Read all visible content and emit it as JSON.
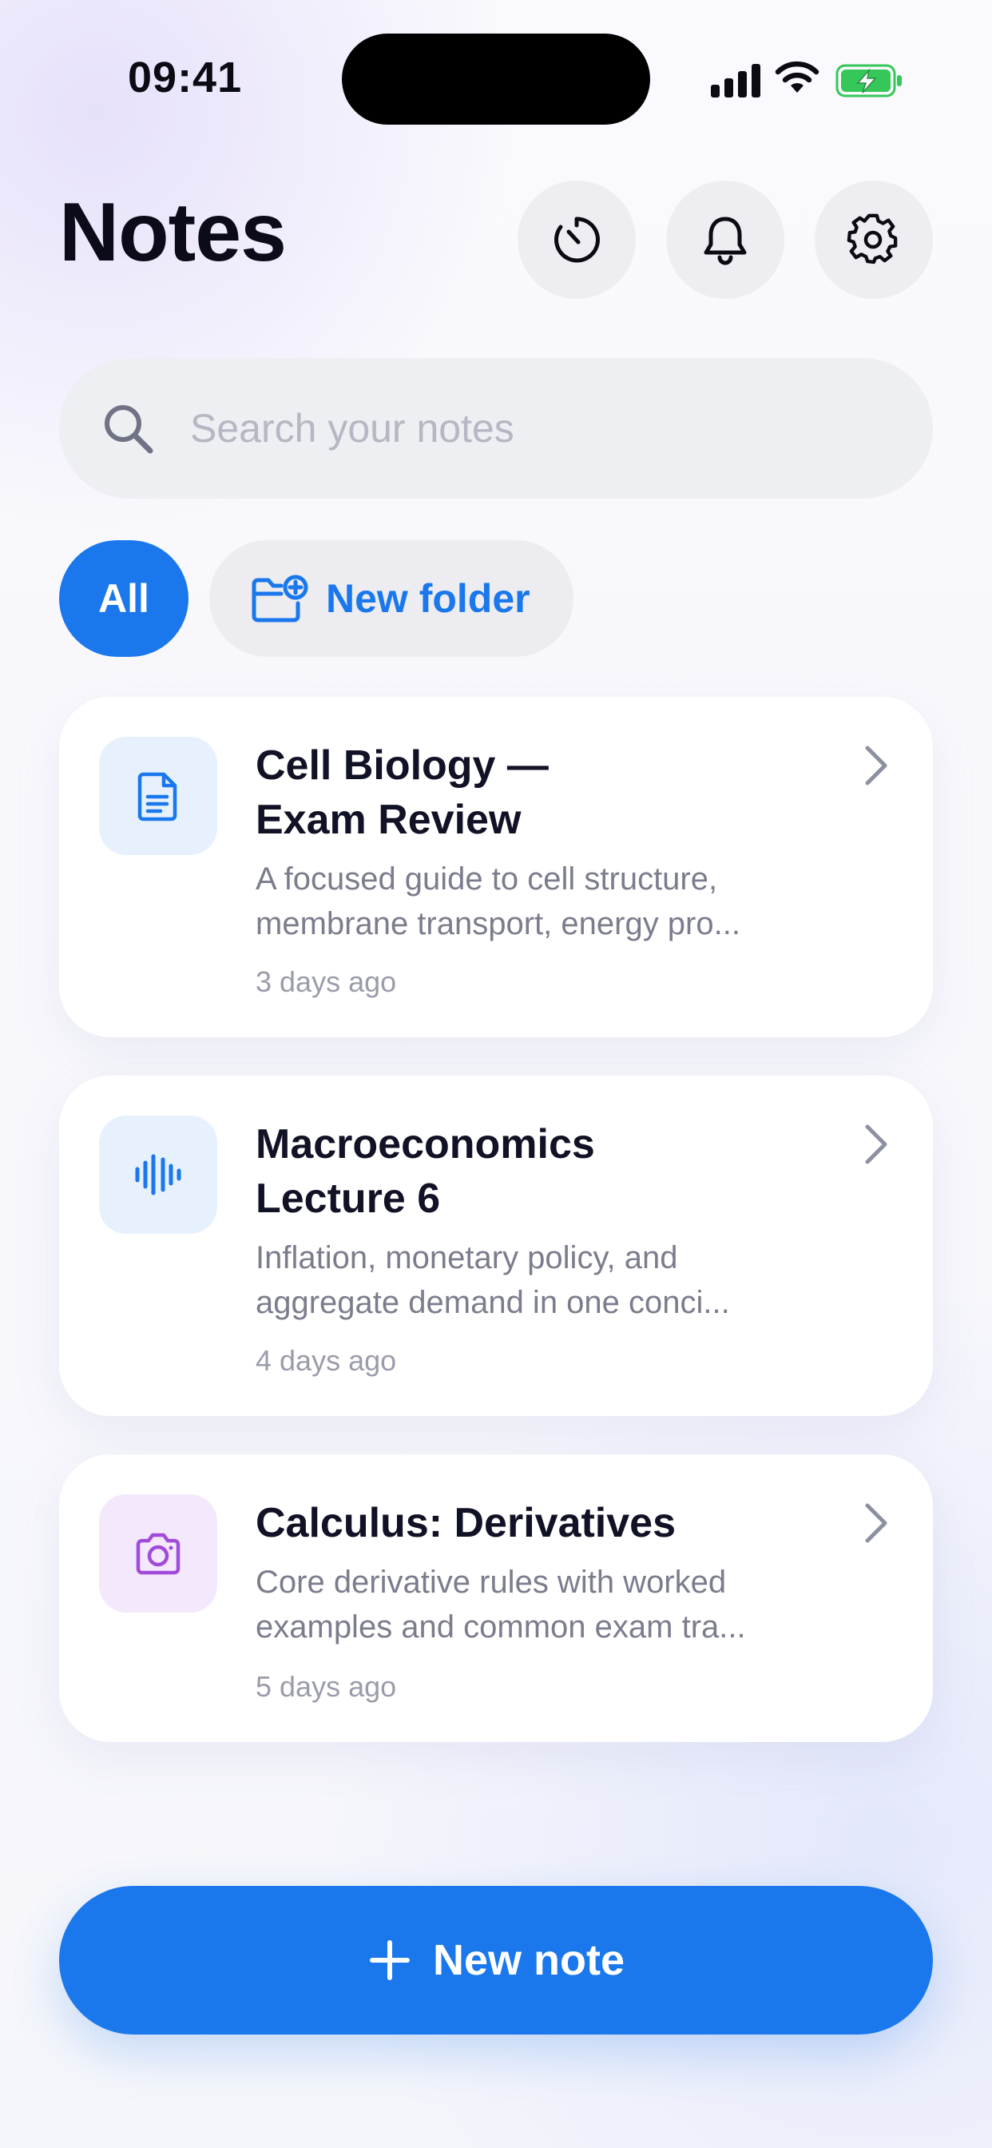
{
  "status_bar": {
    "time": "09:41"
  },
  "header": {
    "title": "Notes",
    "actions": [
      {
        "icon": "timer-icon"
      },
      {
        "icon": "bell-icon"
      },
      {
        "icon": "gear-icon"
      }
    ]
  },
  "search": {
    "placeholder": "Search your notes",
    "value": ""
  },
  "filters": {
    "all_label": "All",
    "new_folder_label": "New folder"
  },
  "notes": [
    {
      "title_line1": "Cell Biology —",
      "title_line2": "Exam Review",
      "desc_line1": "A focused guide to cell structure,",
      "desc_line2": "membrane transport, energy pro...",
      "time": "3 days ago",
      "icon": "document-icon",
      "icon_bg": "#e6f1fd",
      "icon_color": "#1a78ec"
    },
    {
      "title_line1": "Macroeconomics",
      "title_line2": "Lecture 6",
      "desc_line1": "Inflation, monetary policy, and",
      "desc_line2": "aggregate demand in one conci...",
      "time": "4 days ago",
      "icon": "audio-waveform-icon",
      "icon_bg": "#e6f1fd",
      "icon_color": "#1a78ec"
    },
    {
      "title_line1": "Calculus: Derivatives",
      "title_line2": "",
      "desc_line1": "Core derivative rules with worked",
      "desc_line2": "examples and common exam tra...",
      "time": "5 days ago",
      "icon": "camera-icon",
      "icon_bg": "#f4e8fc",
      "icon_color": "#a14bdc"
    }
  ],
  "new_note": {
    "label": "New note"
  },
  "colors": {
    "accent": "#1a78ec",
    "camera_accent": "#a14bdc",
    "battery_green": "#35c759"
  }
}
